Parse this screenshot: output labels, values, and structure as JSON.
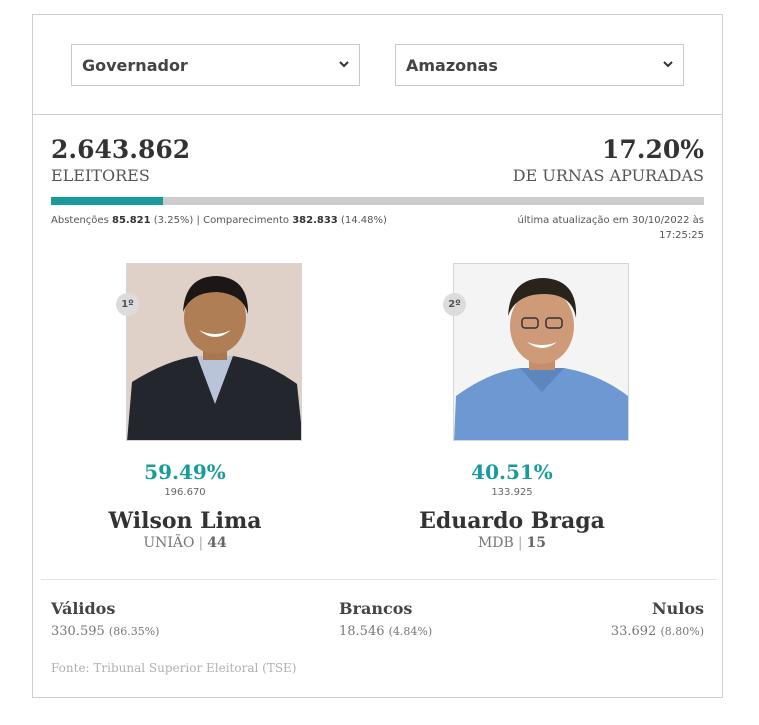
{
  "filters": {
    "office": "Governador",
    "state": "Amazonas"
  },
  "summary": {
    "electors": "2.643.862",
    "electors_label": "ELEITORES",
    "counted_pct": "17.20%",
    "counted_label": "DE URNAS APURADAS",
    "counted_fraction": 0.172,
    "abstention_label": "Abstenções",
    "abstention_value": "85.821",
    "abstention_pct": "(3.25%)",
    "separator": "|",
    "turnout_label": "Comparecimento",
    "turnout_value": "382.833",
    "turnout_pct": "(14.48%)",
    "updated_line1": "última atualização em 30/10/2022 às",
    "updated_line2": "17:25:25"
  },
  "candidates": [
    {
      "rank": "1º",
      "pct": "59.49%",
      "votes": "196.670",
      "name": "Wilson Lima",
      "party": "UNIÃO",
      "number": "44"
    },
    {
      "rank": "2º",
      "pct": "40.51%",
      "votes": "133.925",
      "name": "Eduardo Braga",
      "party": "MDB",
      "number": "15"
    }
  ],
  "totals": {
    "valid_label": "Válidos",
    "valid_value": "330.595",
    "valid_pct": "(86.35%)",
    "blank_label": "Brancos",
    "blank_value": "18.546",
    "blank_pct": "(4.84%)",
    "null_label": "Nulos",
    "null_value": "33.692",
    "null_pct": "(8.80%)"
  },
  "source": "Fonte: Tribunal Superior Eleitoral (TSE)",
  "colors": {
    "accent": "#179b9b",
    "bar_bg": "#cccccc"
  }
}
